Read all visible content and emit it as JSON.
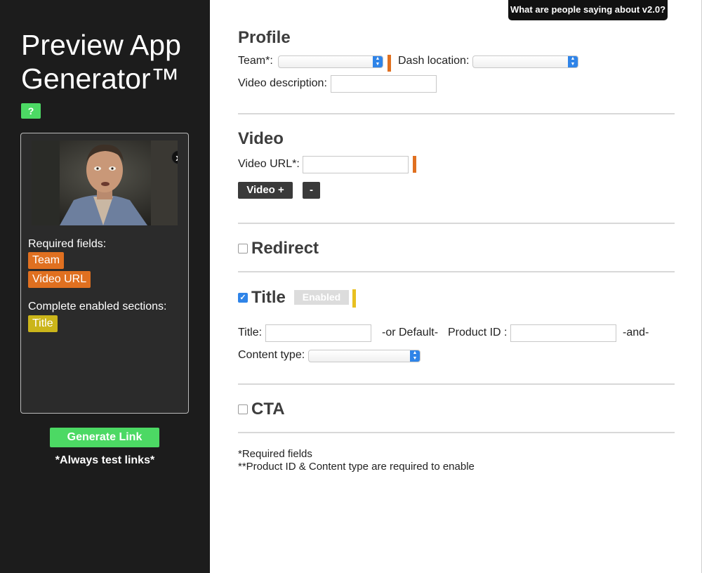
{
  "sidebar": {
    "app_title": "Preview App Generator™",
    "help_label": "?",
    "close_label": "x",
    "required_heading": "Required fields:",
    "required_tags": [
      "Team",
      "Video URL"
    ],
    "enabled_heading": "Complete enabled sections:",
    "enabled_tags": [
      "Title"
    ],
    "generate_label": "Generate Link",
    "test_note": "*Always test links*"
  },
  "header": {
    "feedback_label": "What are people saying about v2.0?"
  },
  "profile": {
    "title": "Profile",
    "team_label": "Team*:",
    "dash_location_label": "Dash location:",
    "video_description_label": "Video description:"
  },
  "video": {
    "title": "Video",
    "url_label": "Video URL*:",
    "add_label": "Video +",
    "remove_label": "-"
  },
  "redirect": {
    "title": "Redirect",
    "checked": false
  },
  "title_section": {
    "title": "Title",
    "checked": true,
    "enabled_badge": "Enabled",
    "title_label": "Title:",
    "or_default": "-or Default-",
    "product_id_label": "Product ID :",
    "and_label": "-and-",
    "content_type_label": "Content type:"
  },
  "cta": {
    "title": "CTA",
    "checked": false
  },
  "footnotes": {
    "required": "*Required fields",
    "product_note": "**Product ID & Content type are required to enable"
  },
  "colors": {
    "sidebar_bg": "#1c1c1c",
    "accent_green": "#4cd964",
    "required_orange": "#e07020",
    "enabled_yellow": "#cbb51a",
    "select_blue": "#2f84e8"
  }
}
